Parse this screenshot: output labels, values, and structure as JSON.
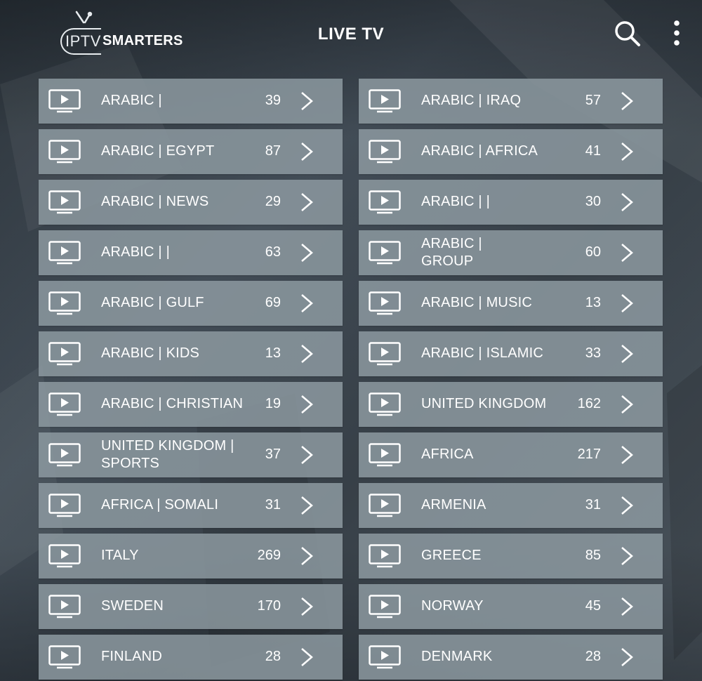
{
  "app": {
    "logo_left": "IPTV",
    "logo_right": "SMARTERS",
    "title": "LIVE TV"
  },
  "icons": {
    "search": "search-icon",
    "menu": "more-vertical-icon",
    "item": "tv-play-icon",
    "arrow": "chevron-right-icon"
  },
  "colors": {
    "item_bg": "#8c99a0",
    "text": "#ffffff"
  },
  "categories": [
    {
      "label": "ARABIC |",
      "count": "39"
    },
    {
      "label": "ARABIC | IRAQ",
      "count": "57"
    },
    {
      "label": "ARABIC | EGYPT",
      "count": "87"
    },
    {
      "label": "ARABIC | AFRICA",
      "count": "41"
    },
    {
      "label": "ARABIC | NEWS",
      "count": "29"
    },
    {
      "label": "ARABIC |          |\n",
      "count": "30"
    },
    {
      "label": "ARABIC |          |\n",
      "count": "63"
    },
    {
      "label": "ARABIC |\nGROUP",
      "count": "60"
    },
    {
      "label": "ARABIC | GULF",
      "count": "69"
    },
    {
      "label": "ARABIC | MUSIC",
      "count": "13"
    },
    {
      "label": "ARABIC | KIDS",
      "count": "13"
    },
    {
      "label": "ARABIC | ISLAMIC",
      "count": "33"
    },
    {
      "label": "ARABIC | CHRISTIAN",
      "count": "19"
    },
    {
      "label": "UNITED KINGDOM",
      "count": "162"
    },
    {
      "label": "UNITED KINGDOM |\nSPORTS",
      "count": "37"
    },
    {
      "label": "AFRICA",
      "count": "217"
    },
    {
      "label": "AFRICA | SOMALI",
      "count": "31"
    },
    {
      "label": "ARMENIA",
      "count": "31"
    },
    {
      "label": "      ITALY",
      "count": "269"
    },
    {
      "label": "GREECE",
      "count": "85"
    },
    {
      "label": "SWEDEN",
      "count": "170"
    },
    {
      "label": "NORWAY",
      "count": "45"
    },
    {
      "label": "FINLAND",
      "count": "28"
    },
    {
      "label": "DENMARK",
      "count": "28"
    }
  ]
}
